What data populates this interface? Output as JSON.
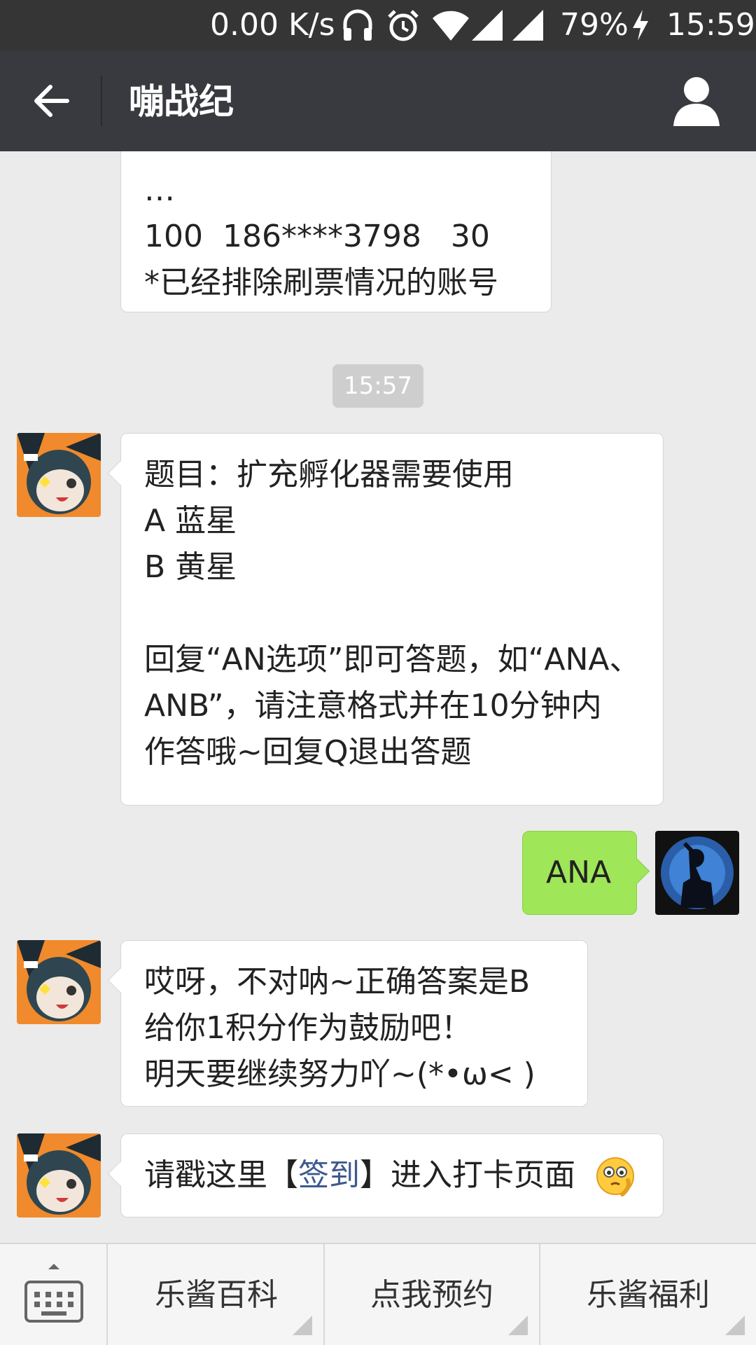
{
  "status_bar": {
    "net_speed": "0.00 K/s",
    "battery": "79%",
    "time": "15:59"
  },
  "header": {
    "title": "嘣战纪"
  },
  "messages": {
    "m0": {
      "lines": [
        "…",
        "100  186****3798   30",
        "*已经排除刷票情况的账号"
      ]
    },
    "timestamp": "15:57",
    "m1": {
      "lines": [
        "题目：扩充孵化器需要使用",
        "A 蓝星",
        "B 黄星",
        "",
        "回复“AN选项”即可答题，如“ANA、",
        "ANB”，请注意格式并在10分钟内",
        "作答哦~回复Q退出答题"
      ]
    },
    "m2": {
      "text": "ANA"
    },
    "m3": {
      "lines": [
        "哎呀，不对呐~正确答案是B",
        "给你1积分作为鼓励吧！",
        "明天要继续努力吖~(*•ω< )"
      ]
    },
    "m4": {
      "prefix": "请戳这里【",
      "link": "签到",
      "suffix": "】进入打卡页面"
    }
  },
  "bottom_menu": {
    "items": [
      "乐酱百科",
      "点我预约",
      "乐酱福利"
    ]
  }
}
